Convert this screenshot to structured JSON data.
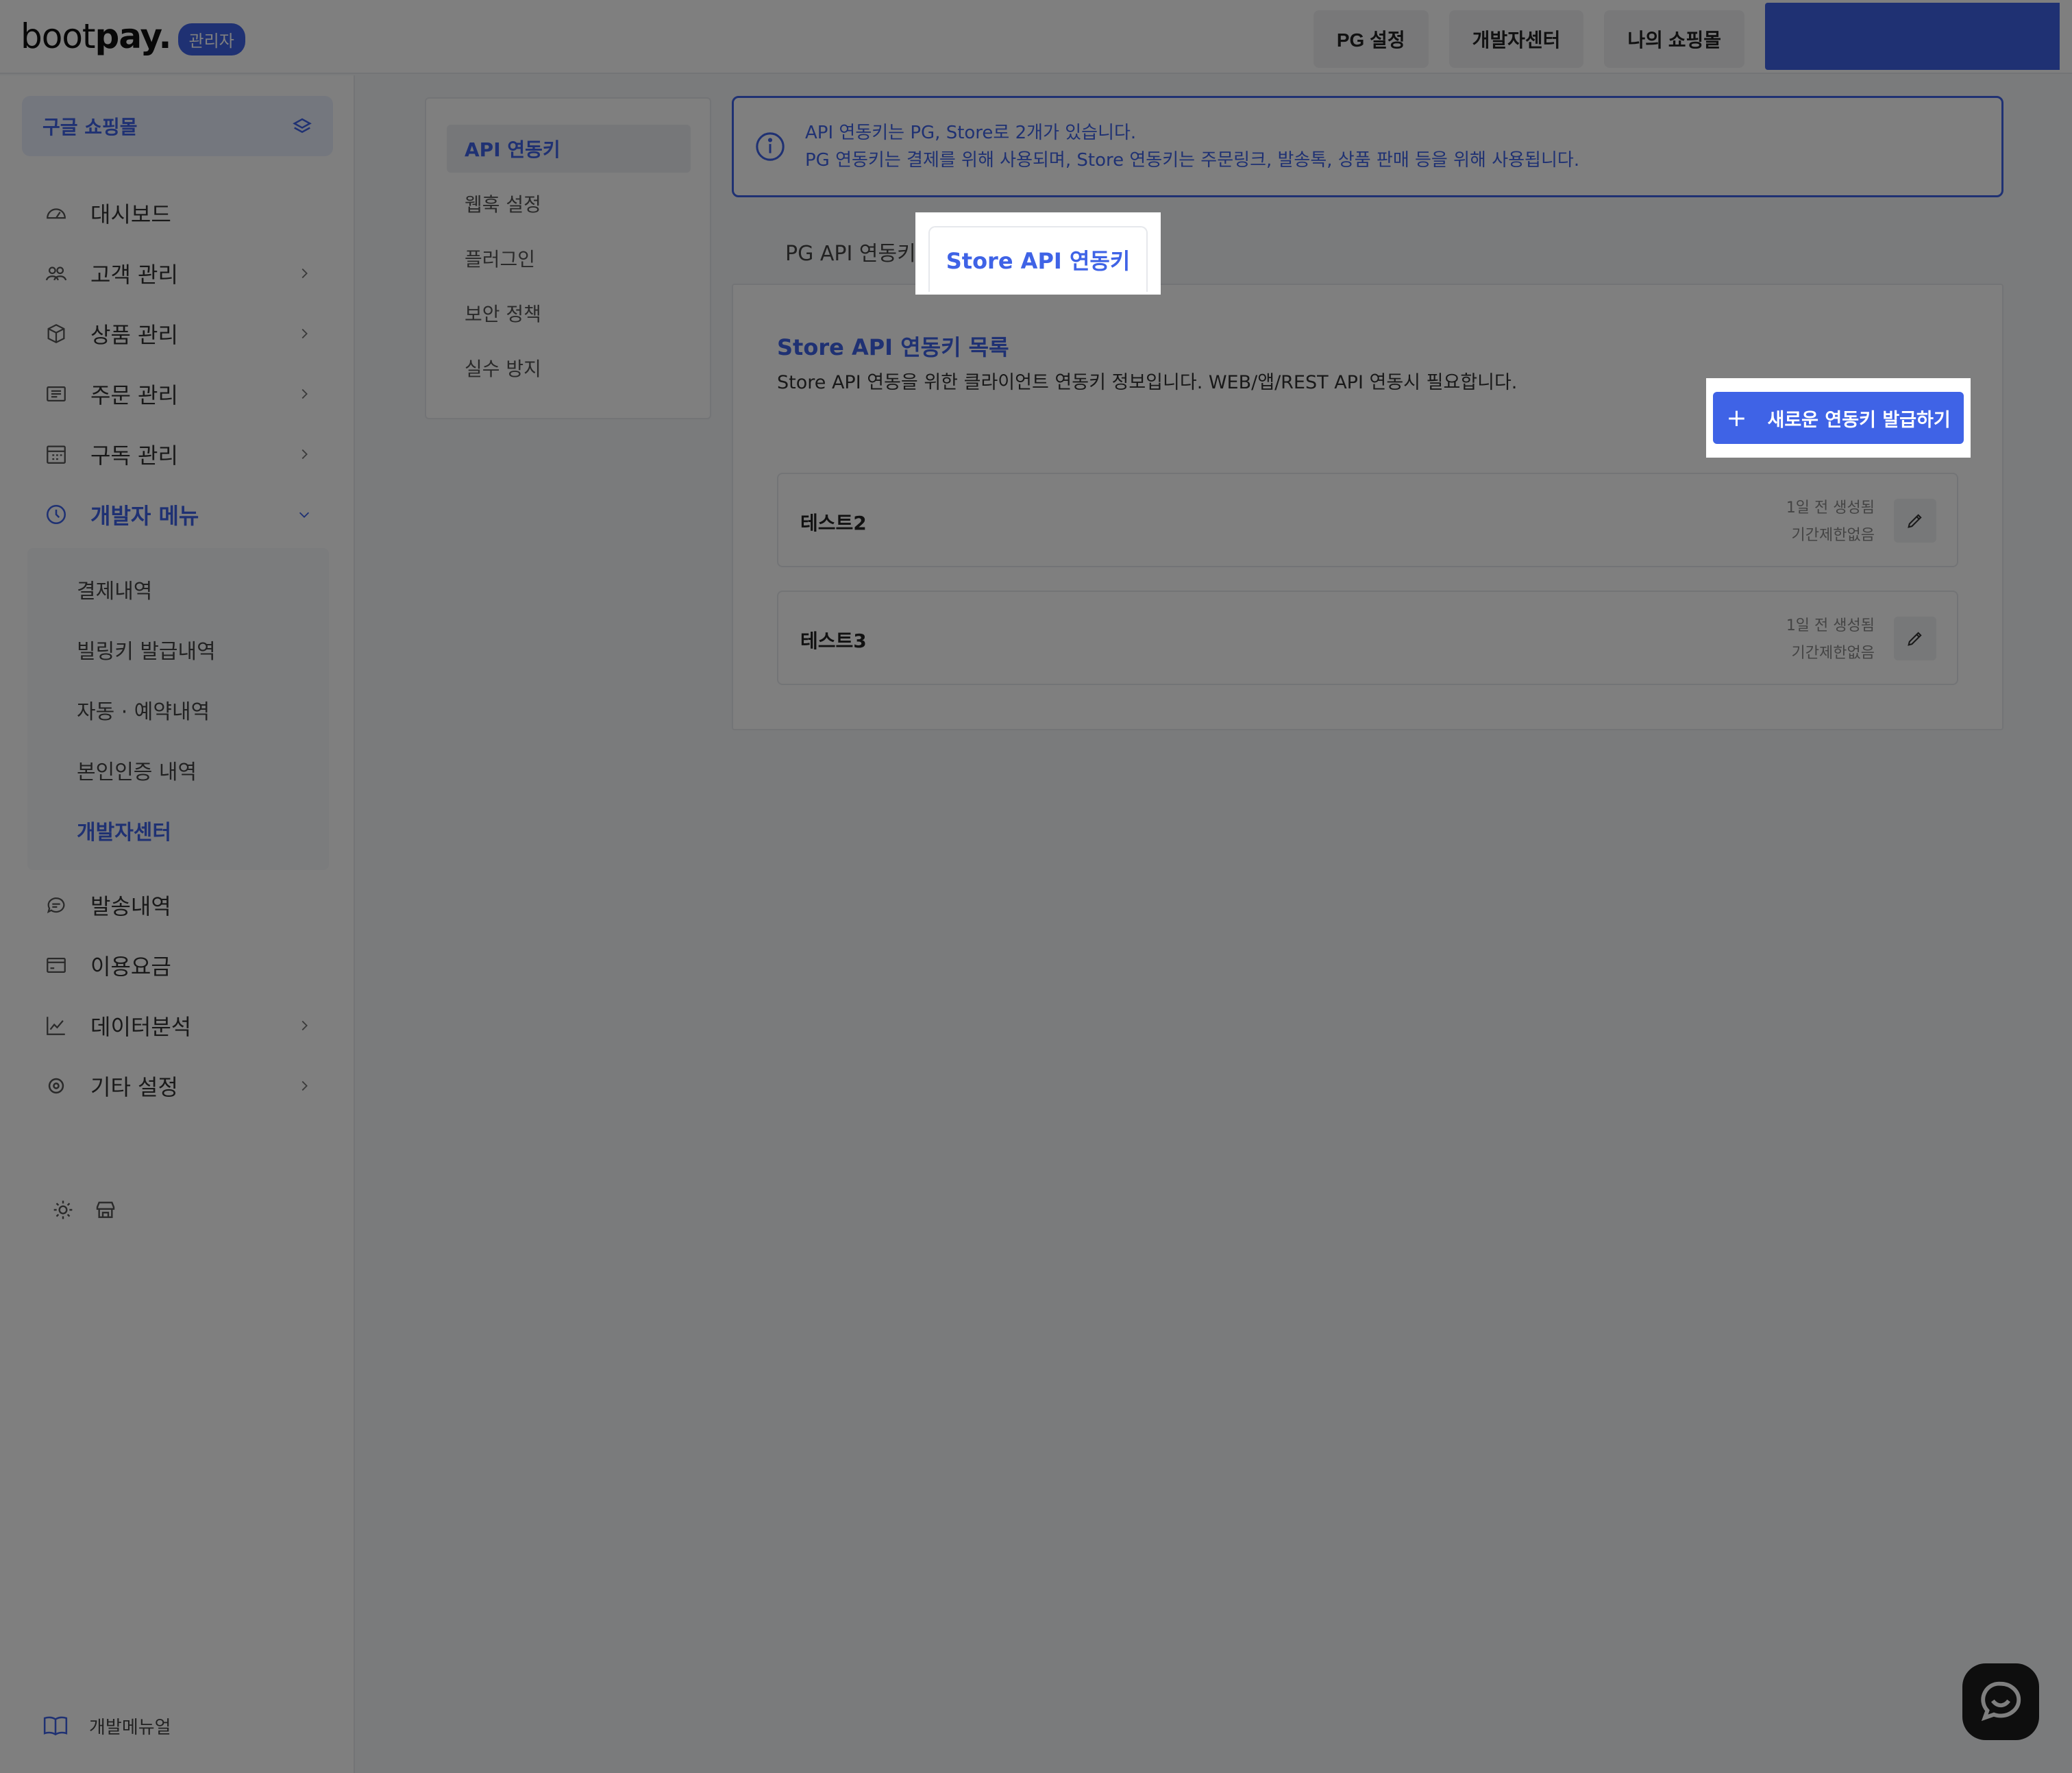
{
  "header": {
    "logo_text_light": "boot",
    "logo_text_bold": "pay.",
    "admin_badge": "관리자",
    "nav": [
      "PG 설정",
      "개발자센터",
      "나의 쇼핑몰"
    ]
  },
  "sidebar": {
    "store_name": "구글 쇼핑몰",
    "items": [
      {
        "label": "대시보드",
        "icon": "dashboard-icon"
      },
      {
        "label": "고객 관리",
        "icon": "users-icon"
      },
      {
        "label": "상품 관리",
        "icon": "box-icon"
      },
      {
        "label": "주문 관리",
        "icon": "list-icon"
      },
      {
        "label": "구독 관리",
        "icon": "calendar-icon"
      },
      {
        "label": "개발자 메뉴",
        "icon": "clock-icon"
      }
    ],
    "dev_submenu": [
      "결제내역",
      "빌링키 발급내역",
      "자동 · 예약내역",
      "본인인증 내역",
      "개발자센터"
    ],
    "items_bottom": [
      {
        "label": "발송내역",
        "icon": "message-icon"
      },
      {
        "label": "이용요금",
        "icon": "card-icon"
      },
      {
        "label": "데이터분석",
        "icon": "chart-icon"
      },
      {
        "label": "기타 설정",
        "icon": "gear-icon"
      }
    ],
    "manual_label": "개발메뉴얼"
  },
  "subnav": {
    "items": [
      "API 연동키",
      "웹훅 설정",
      "플러그인",
      "보안 정책",
      "실수 방지"
    ]
  },
  "info": {
    "line1": "API 연동키는 PG, Store로 2개가 있습니다.",
    "line2": "PG 연동키는 결제를 위해 사용되며, Store 연동키는 주문링크, 발송톡, 상품 판매 등을 위해 사용됩니다."
  },
  "tabs": {
    "pg": "PG API 연동키",
    "store": "Store API 연동키"
  },
  "panel": {
    "title": "Store API 연동키 목록",
    "description": "Store API 연동을 위한 클라이언트 연동키 정보입니다. WEB/앱/REST API 연동시 필요합니다.",
    "new_key_button": "새로운 연동키 발급하기",
    "keys": [
      {
        "name": "테스트2",
        "created": "1일 전 생성됨",
        "expiry": "기간제한없음"
      },
      {
        "name": "테스트3",
        "created": "1일 전 생성됨",
        "expiry": "기간제한없음"
      }
    ]
  },
  "colors": {
    "accent": "#3f63e6",
    "overlay": "rgba(0,0,0,0.5)"
  }
}
